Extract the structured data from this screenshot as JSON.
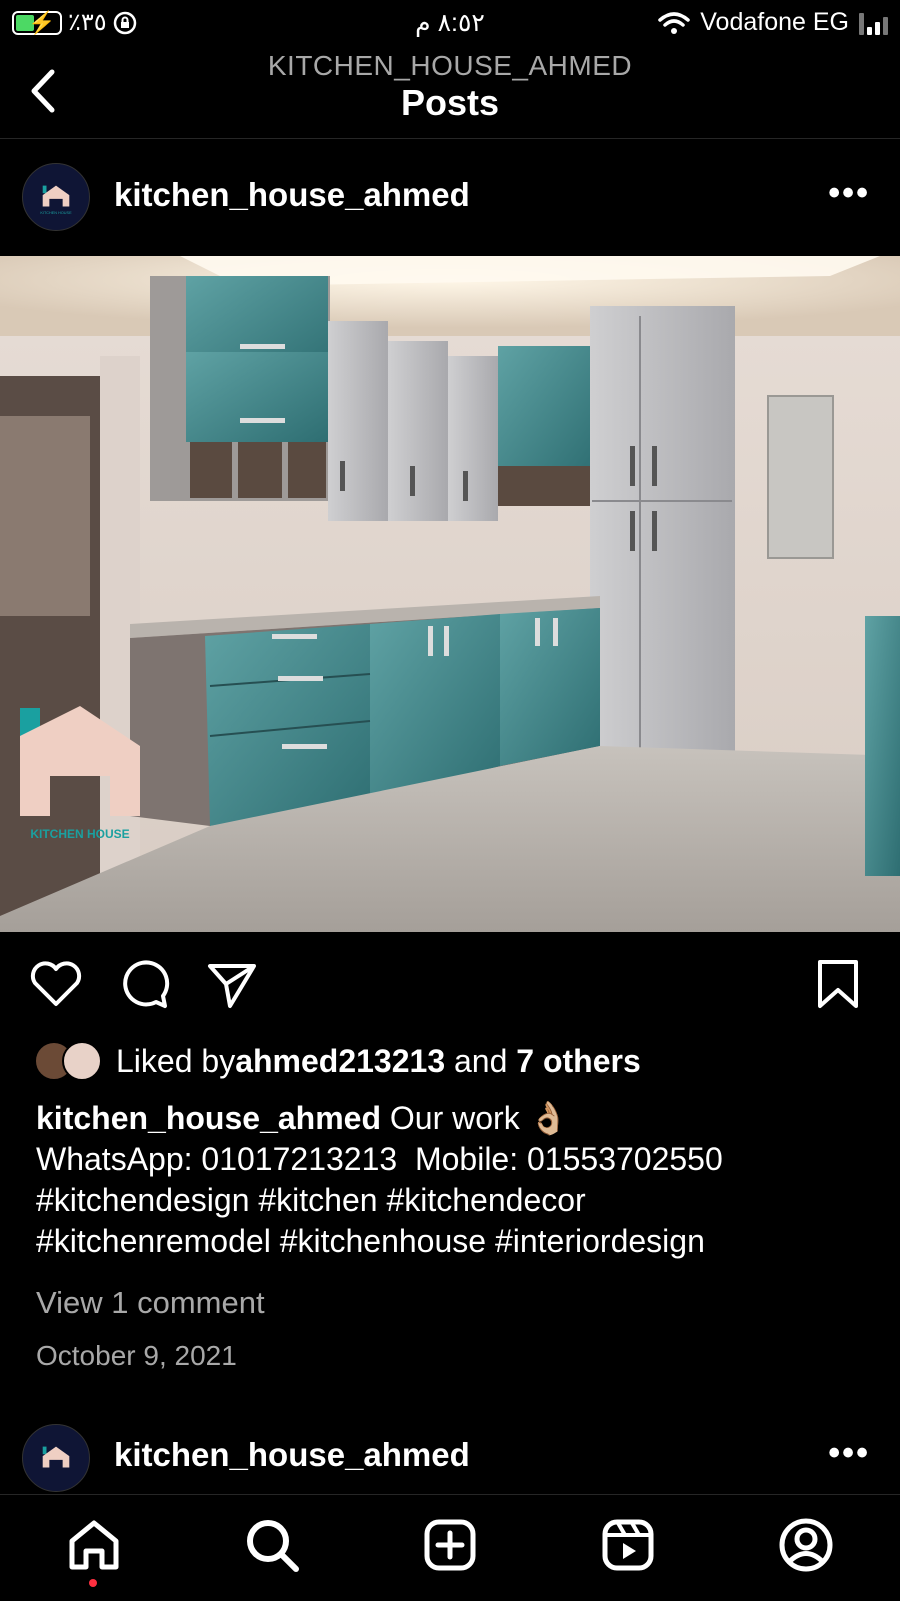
{
  "status_bar": {
    "battery_percent": "٪٣٥",
    "time": "٨:٥٢ م",
    "carrier": "Vodafone EG"
  },
  "nav": {
    "account": "KITCHEN_HOUSE_AHMED",
    "title": "Posts"
  },
  "post": {
    "username": "kitchen_house_ahmed",
    "photo_watermark": "KITCHEN HOUSE",
    "liked_by_prefix": "Liked by ",
    "liked_by_user": "ahmed213213",
    "liked_by_and": " and ",
    "liked_by_others": "7 others",
    "caption_user": "kitchen_house_ahmed",
    "caption_text": "Our work 👌🏼",
    "caption_line2": "WhatsApp: 01017213213  Mobile: 01553702550",
    "caption_line3": "#kitchendesign #kitchen #kitchendecor",
    "caption_line4": "#kitchenremodel #kitchenhouse #interiordesign",
    "view_comments": "View 1 comment",
    "date": "October 9, 2021"
  },
  "next_post": {
    "username": "kitchen_house_ahmed"
  },
  "icons": {
    "back": "chevron-left-icon",
    "more": "more-horizontal-icon",
    "like": "heart-icon",
    "comment": "comment-icon",
    "share": "paper-plane-icon",
    "save": "bookmark-icon",
    "home": "home-icon",
    "search": "search-icon",
    "create": "plus-square-icon",
    "reels": "reels-icon",
    "profile": "profile-icon"
  },
  "colors": {
    "background": "#000000",
    "secondary_text": "#a8a8a8",
    "notification_dot": "#ff3040",
    "battery_green": "#4cd964"
  }
}
